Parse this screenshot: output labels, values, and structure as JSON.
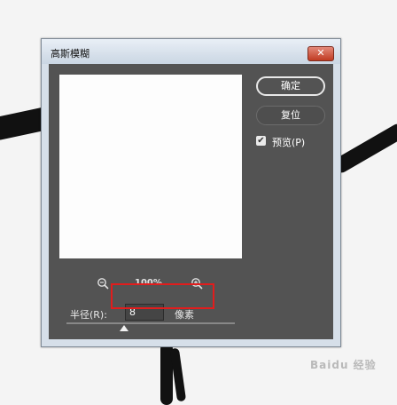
{
  "window": {
    "title": "高斯模糊",
    "close_glyph": "✕"
  },
  "buttons": {
    "ok_label": "确定",
    "reset_label": "复位"
  },
  "preview_option": {
    "label": "预览(P)",
    "checked": true,
    "check_glyph": "✔"
  },
  "zoom": {
    "level": "100%",
    "zoom_out_icon": "zoom-out-icon",
    "zoom_in_icon": "zoom-in-icon"
  },
  "radius": {
    "label": "半径(R):",
    "value": "8",
    "unit": "像素",
    "slider_fraction": 0.34
  },
  "watermark": "Baidu 经验",
  "colors": {
    "highlight": "#e11d1d",
    "panel": "#535353",
    "titlebar": "#d6dfe9",
    "close_button": "#c03b22"
  }
}
